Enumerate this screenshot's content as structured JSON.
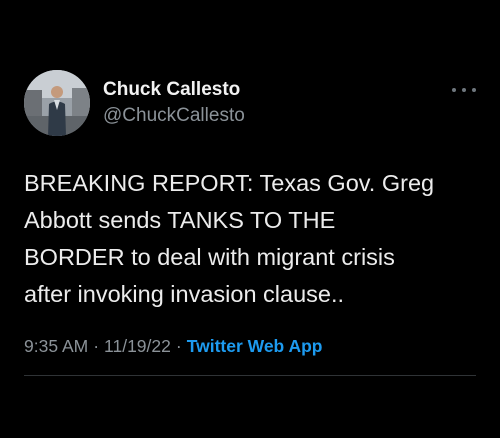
{
  "author": {
    "display_name": "Chuck Callesto",
    "handle": "@ChuckCallesto",
    "avatar_icon": "profile-photo"
  },
  "tweet": {
    "text": "BREAKING REPORT: Texas Gov. Greg\nAbbott sends TANKS TO THE\nBORDER to deal with migrant crisis\nafter invoking invasion clause.."
  },
  "meta": {
    "time": "9:35 AM",
    "separator": "·",
    "date": "11/19/22",
    "source": "Twitter Web App"
  },
  "menu": {
    "icon": "more-horizontal-icon"
  },
  "colors": {
    "background": "#000000",
    "text": "#e7e9ea",
    "secondary_text": "#8b9298",
    "link": "#1d9bf0",
    "divider": "#2f3336"
  }
}
